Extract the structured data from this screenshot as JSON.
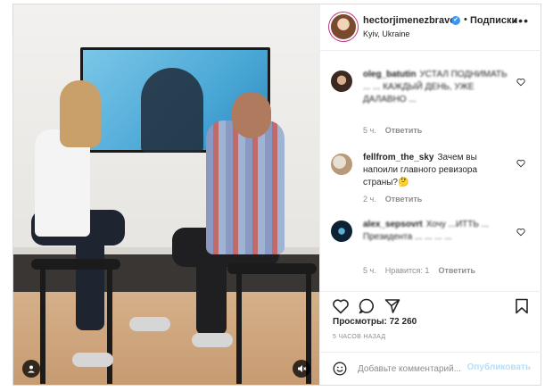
{
  "post": {
    "username": "hectorjimenezbravo",
    "verified": "✔",
    "separator": "•",
    "follow_label": "Подписки",
    "location": "Kyiv, Ukraine",
    "more_icon": "•••"
  },
  "comments": [
    {
      "user": "oleg_batutin",
      "text": "УСТАЛ ПОДНИМАТЬ ... ... КАЖДЫЙ ДЕНЬ, УЖЕ ДАЛАВНО ...",
      "time": "5 ч.",
      "likes": "",
      "reply": "Ответить"
    },
    {
      "user": "fellfrom_the_sky",
      "text": "Зачем вы напоили главного ревизора страны?🤔",
      "time": "2 ч.",
      "likes": "",
      "reply": "Ответить"
    },
    {
      "user": "alex_sepsovrt",
      "text": "Хочу ...ИТТЬ ... Президента ... ... ... ...",
      "time": "5 ч.",
      "likes": "Нравится: 1",
      "reply": "Ответить"
    }
  ],
  "stats": {
    "views": "Просмотры: 72 260",
    "time_ago": "5 ЧАСОВ НАЗАД"
  },
  "composer": {
    "placeholder": "Добавьте комментарий...",
    "publish_label": "Опубликовать"
  },
  "colors": {
    "accent": "#3897f0",
    "publish_disabled": "#b2dffc",
    "muted": "#8e8e8e"
  }
}
